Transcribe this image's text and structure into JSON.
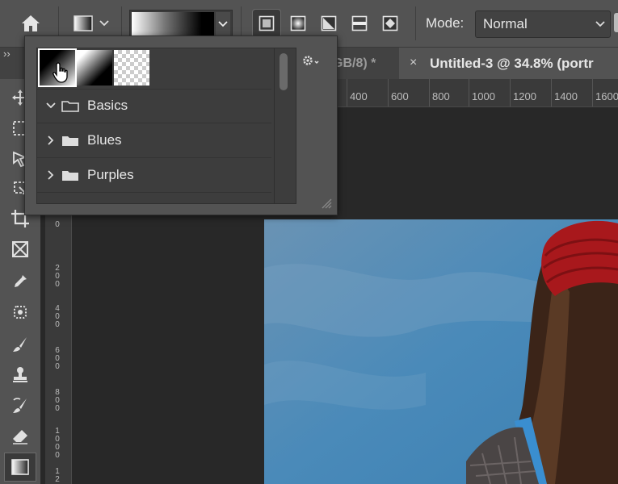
{
  "options_bar": {
    "mode_label": "Mode:",
    "mode_value": "Normal"
  },
  "tabs": [
    {
      "label": "GB/8) *"
    },
    {
      "label": "Untitled-3 @ 34.8% (portr"
    }
  ],
  "tab_close_glyph": "×",
  "ruler": {
    "h_ticks": [
      "400",
      "600",
      "800",
      "1000",
      "1200",
      "1400",
      "1600"
    ],
    "v_ticks": [
      "0",
      "200",
      "400",
      "600",
      "800",
      "1000",
      "12"
    ]
  },
  "gradient_panel": {
    "folders": [
      {
        "label": "Basics",
        "expanded": true
      },
      {
        "label": "Blues",
        "expanded": false
      },
      {
        "label": "Purples",
        "expanded": false
      }
    ]
  },
  "colors": {
    "ui_bar": "#535353",
    "panel_list": "#3d3d3d",
    "canvas": "#282828",
    "hat_red": "#a8181c",
    "sky_blue": "#4a8ab9"
  },
  "icons": [
    "home-icon",
    "gradient-picker-icon",
    "chevron-down-icon",
    "linear-gradient-icon",
    "radial-gradient-icon",
    "angle-gradient-icon",
    "reflected-gradient-icon",
    "diamond-gradient-icon",
    "gear-icon",
    "folder-icon",
    "hand-cursor-icon",
    "move-tool-icon",
    "marquee-tool-icon",
    "lasso-tool-icon",
    "crop-tool-icon",
    "frame-tool-icon",
    "eyedropper-icon",
    "heal-icon",
    "brush-icon",
    "stamp-icon",
    "history-brush-icon",
    "eraser-icon",
    "gradient-tool-icon"
  ]
}
